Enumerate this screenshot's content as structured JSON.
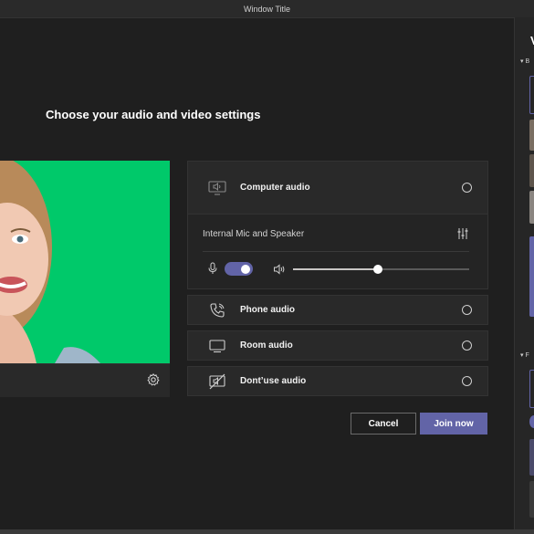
{
  "window": {
    "title": "Window Title"
  },
  "main": {
    "heading": "Choose your audio and video settings"
  },
  "audio": {
    "computer_label": "Computer audio",
    "device_name": "Internal Mic and Speaker",
    "mic_enabled": true,
    "volume_fraction": 0.48,
    "phone_label": "Phone audio",
    "room_label": "Room audio",
    "none_label": "Dont’use audio"
  },
  "actions": {
    "cancel_label": "Cancel",
    "join_label": "Join now"
  },
  "side_panel": {
    "title_initial": "V",
    "section_b": "B",
    "section_f": "F"
  },
  "colors": {
    "accent": "#6264a7",
    "preview_bg": "#00c96a",
    "background": "#1f1f1f"
  },
  "icons": {
    "settings": "gear-icon",
    "computer": "monitor-speaker-icon",
    "equalizer": "equalizer-icon",
    "mic": "microphone-icon",
    "speaker": "speaker-icon",
    "phone": "phone-icon",
    "room": "room-device-icon",
    "none": "no-audio-icon"
  }
}
